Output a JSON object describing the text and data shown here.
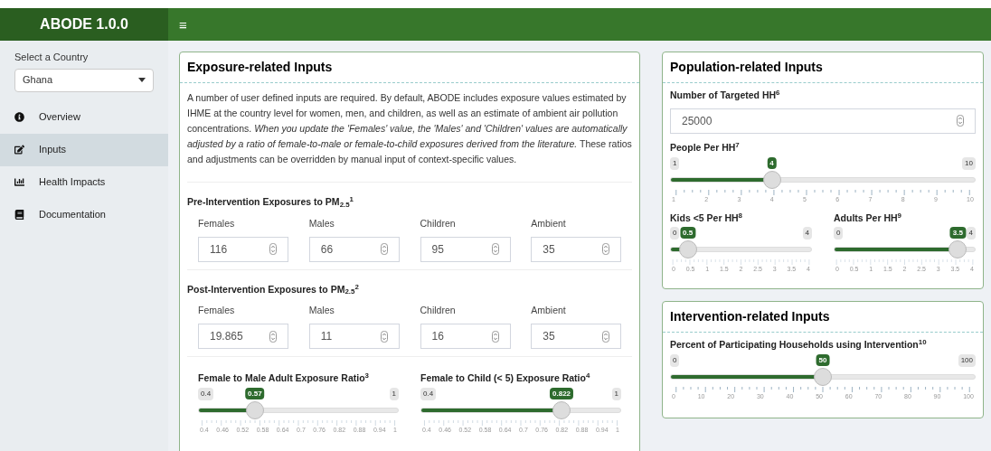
{
  "header": {
    "title": "ABODE 1.0.0",
    "menu_glyph": "≡"
  },
  "sidebar": {
    "select_label": "Select a Country",
    "select_value": "Ghana",
    "items": [
      {
        "label": "Overview",
        "selected": false
      },
      {
        "label": "Inputs",
        "selected": true
      },
      {
        "label": "Health Impacts",
        "selected": false
      },
      {
        "label": "Documentation",
        "selected": false
      }
    ]
  },
  "exposure": {
    "title": "Exposure-related Inputs",
    "intro": "A number of user defined inputs are required. By default, ABODE includes exposure values estimated by IHME at the country level for women, men, and children, as well as an estimate of ambient air pollution concentrations. *When you update the 'Females' value, the 'Males' and 'Children' values are automatically adjusted by a ratio of female-to-male or female-to-child exposures derived from the literature.* These ratios and adjustments can be overridden by manual input of context-specific values.",
    "groups": [
      {
        "title": "Pre-Intervention Exposures to PM$_{2.5}$$^{1}$",
        "fields": [
          {
            "label": "Females",
            "value": "116"
          },
          {
            "label": "Males",
            "value": "66"
          },
          {
            "label": "Children",
            "value": "95"
          },
          {
            "label": "Ambient",
            "value": "35"
          }
        ]
      },
      {
        "title": "Post-Intervention Exposures to PM$_{2.5}$$^{2}$",
        "fields": [
          {
            "label": "Females",
            "value": "19.865"
          },
          {
            "label": "Males",
            "value": "11"
          },
          {
            "label": "Children",
            "value": "16"
          },
          {
            "label": "Ambient",
            "value": "35"
          }
        ]
      }
    ],
    "sliders": [
      {
        "label": "Female to Male Adult Exposure Ratio$^{3}$",
        "min": "0.4",
        "max": "1",
        "value": "0.57",
        "level": 0.283,
        "ticks": [
          "0.4",
          "0.46",
          "0.52",
          "0.58",
          "0.64",
          "0.7",
          "0.76",
          "0.82",
          "0.88",
          "0.94",
          "1"
        ]
      },
      {
        "label": "Female to Child (< 5) Exposure Ratio$^{4}$",
        "min": "0.4",
        "max": "1",
        "value": "0.822",
        "level": 0.703,
        "ticks": [
          "0.4",
          "0.46",
          "0.52",
          "0.58",
          "0.64",
          "0.7",
          "0.76",
          "0.82",
          "0.88",
          "0.94",
          "1"
        ]
      }
    ]
  },
  "population": {
    "title": "Population-related Inputs",
    "targeted_label": "Number of Targeted HH$^{6}$",
    "targeted_value": "25000",
    "people": {
      "label": "People Per HH$^{7}$",
      "min": "1",
      "max": "10",
      "value": "4",
      "level": 0.333,
      "ticks": [
        "1",
        "2",
        "3",
        "4",
        "5",
        "6",
        "7",
        "8",
        "9",
        "10"
      ]
    },
    "pair": [
      {
        "label": "Kids <5 Per HH$^{8}$",
        "min": "0",
        "max": "4",
        "value": "0.5",
        "level": 0.125,
        "ticks": [
          "0",
          "0.5",
          "1",
          "1.5",
          "2",
          "2.5",
          "3",
          "3.5",
          "4"
        ]
      },
      {
        "label": "Adults Per HH$^{9}$",
        "min": "0",
        "max": "4",
        "value": "3.5",
        "level": 0.875,
        "ticks": [
          "0",
          "0.5",
          "1",
          "1.5",
          "2",
          "2.5",
          "3",
          "3.5",
          "4"
        ]
      }
    ]
  },
  "intervention": {
    "title": "Intervention-related Inputs",
    "slider": {
      "label": "Percent of Participating Households using Intervention$^{10}$",
      "min": "0",
      "max": "100",
      "value": "50",
      "level": 0.5,
      "ticks": [
        "0",
        "10",
        "20",
        "30",
        "40",
        "50",
        "60",
        "70",
        "80",
        "90",
        "100"
      ]
    }
  }
}
